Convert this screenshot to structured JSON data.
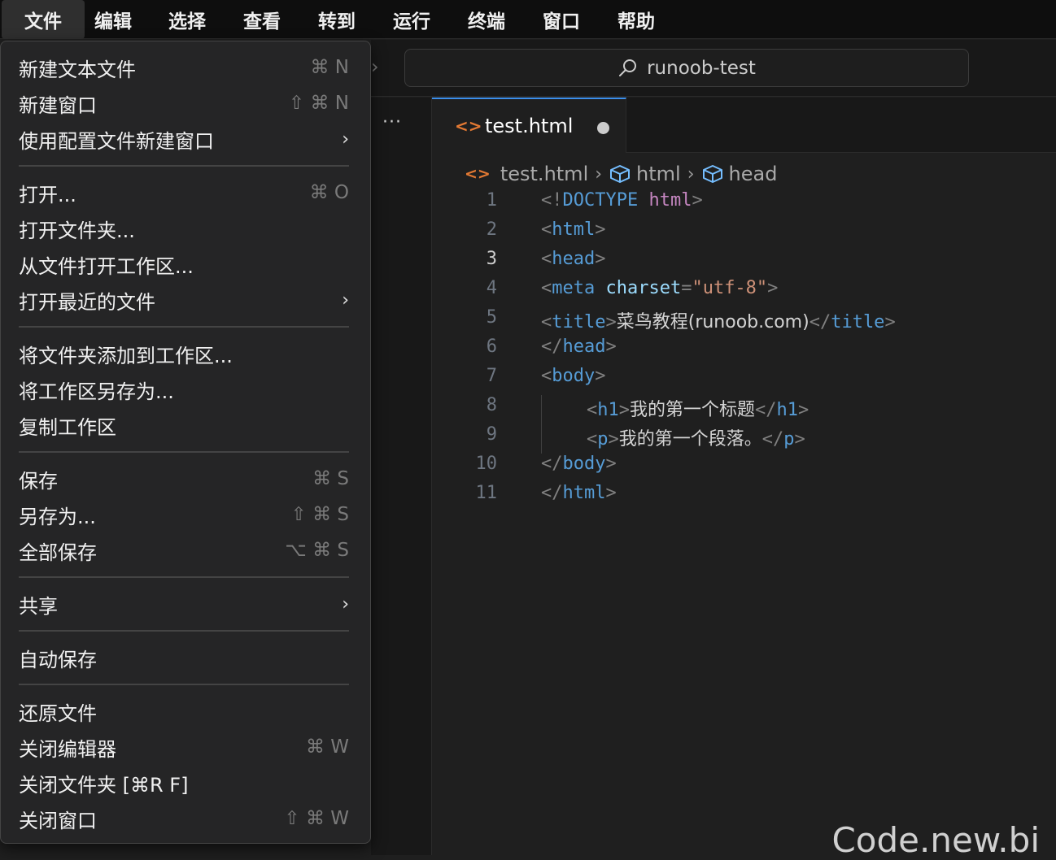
{
  "menubar": {
    "items": [
      "文件",
      "编辑",
      "选择",
      "查看",
      "转到",
      "运行",
      "终端",
      "窗口",
      "帮助"
    ]
  },
  "titlebar": {
    "search_text": "runoob-test"
  },
  "sidepanel": {
    "more": "···"
  },
  "tab": {
    "label": "test.html"
  },
  "breadcrumb": {
    "file": "test.html",
    "seg1": "html",
    "seg2": "head"
  },
  "code": {
    "line_numbers": [
      "1",
      "2",
      "3",
      "4",
      "5",
      "6",
      "7",
      "8",
      "9",
      "10",
      "11"
    ],
    "current_line": "3",
    "text_title": "菜鸟教程(runoob.com)",
    "text_h1": "我的第一个标题",
    "text_p": "我的第一个段落。"
  },
  "file_menu": {
    "groups": [
      [
        {
          "label": "新建文本文件",
          "shortcut": "⌘ N"
        },
        {
          "label": "新建窗口",
          "shortcut": "⇧ ⌘ N"
        },
        {
          "label": "使用配置文件新建窗口",
          "submenu": true
        }
      ],
      [
        {
          "label": "打开...",
          "shortcut": "⌘ O"
        },
        {
          "label": "打开文件夹..."
        },
        {
          "label": "从文件打开工作区..."
        },
        {
          "label": "打开最近的文件",
          "submenu": true
        }
      ],
      [
        {
          "label": "将文件夹添加到工作区..."
        },
        {
          "label": "将工作区另存为..."
        },
        {
          "label": "复制工作区"
        }
      ],
      [
        {
          "label": "保存",
          "shortcut": "⌘ S"
        },
        {
          "label": "另存为...",
          "shortcut": "⇧ ⌘ S"
        },
        {
          "label": "全部保存",
          "shortcut": "⌥ ⌘ S"
        }
      ],
      [
        {
          "label": "共享",
          "submenu": true
        }
      ],
      [
        {
          "label": "自动保存"
        }
      ],
      [
        {
          "label": "还原文件"
        },
        {
          "label": "关闭编辑器",
          "shortcut": "⌘ W"
        },
        {
          "label": "关闭文件夹 [⌘R F]"
        },
        {
          "label": "关闭窗口",
          "shortcut": "⇧ ⌘ W"
        }
      ]
    ]
  },
  "watermark": "Code.new.bi",
  "colors": {
    "accent": "#3b8eea",
    "html_file_icon": "#e37933",
    "menu_bg": "#252526",
    "editor_bg": "#1f1f1f"
  }
}
